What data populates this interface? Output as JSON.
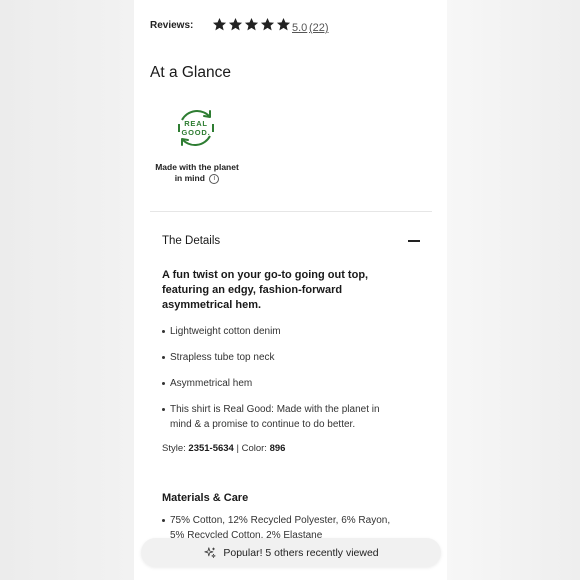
{
  "reviews": {
    "label": "Reviews:",
    "rating": "5.0",
    "count": "(22)",
    "stars_filled": 5,
    "star_color": "#222222",
    "star_icon": "star-icon"
  },
  "glance": {
    "title": "At a Glance",
    "badge": {
      "line1": "REAL",
      "line2": "GOOD.",
      "color": "#2e7d32",
      "icon": "recycle-arrows-icon"
    },
    "caption_line1": "Made with the planet",
    "caption_line2": "in mind",
    "info_icon": "info-icon",
    "info_glyph": "i"
  },
  "details": {
    "title": "The Details",
    "toggle_icon": "minus-icon",
    "headline": "A fun twist on your go-to going out top, featuring an edgy, fashion-forward asymmetrical hem.",
    "bullets": [
      "Lightweight cotton denim",
      "Strapless tube top neck",
      "Asymmetrical hem",
      "This shirt is Real Good: Made with the planet in mind & a promise to continue to do better."
    ],
    "style_label": "Style:",
    "style_value": "2351-5634",
    "separator": "|",
    "color_label": "Color:",
    "color_value": "896"
  },
  "materials": {
    "title": "Materials & Care",
    "items": [
      "75% Cotton, 12% Recycled Polyester, 6% Rayon, 5% Recycled Cotton, 2% Elastane"
    ]
  },
  "toast": {
    "text": "Popular! 5 others recently viewed",
    "icon": "sparkle-icon"
  }
}
